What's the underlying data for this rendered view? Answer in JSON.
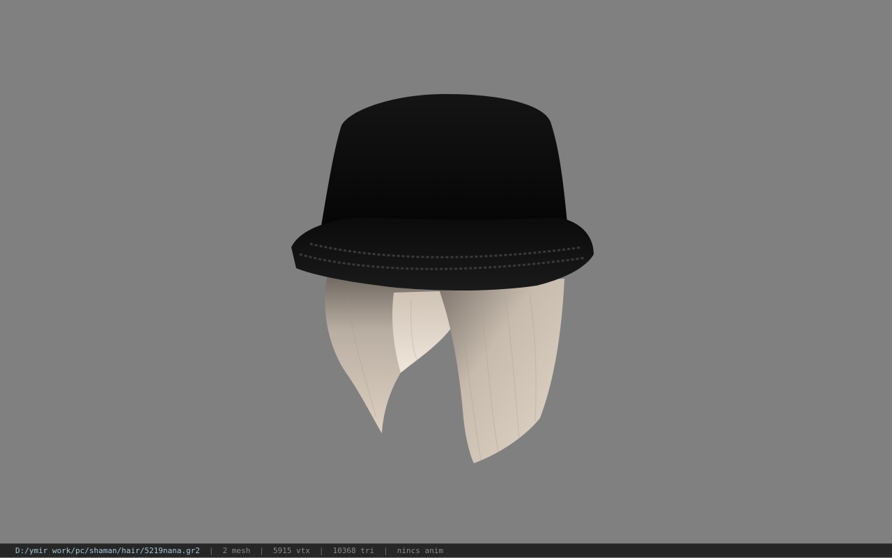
{
  "viewer": {
    "background_color": "#808080",
    "model": {
      "hat_color": "#050505",
      "hair_color": "#d9ccbd"
    }
  },
  "status_bar": {
    "file_path": "D:/ymir work/pc/shaman/hair/5219nana.gr2",
    "separator": "|",
    "mesh_count": "2 mesh",
    "vertex_count": "5915 vtx",
    "triangle_count": "10368 tri",
    "animation": "nincs anim"
  }
}
